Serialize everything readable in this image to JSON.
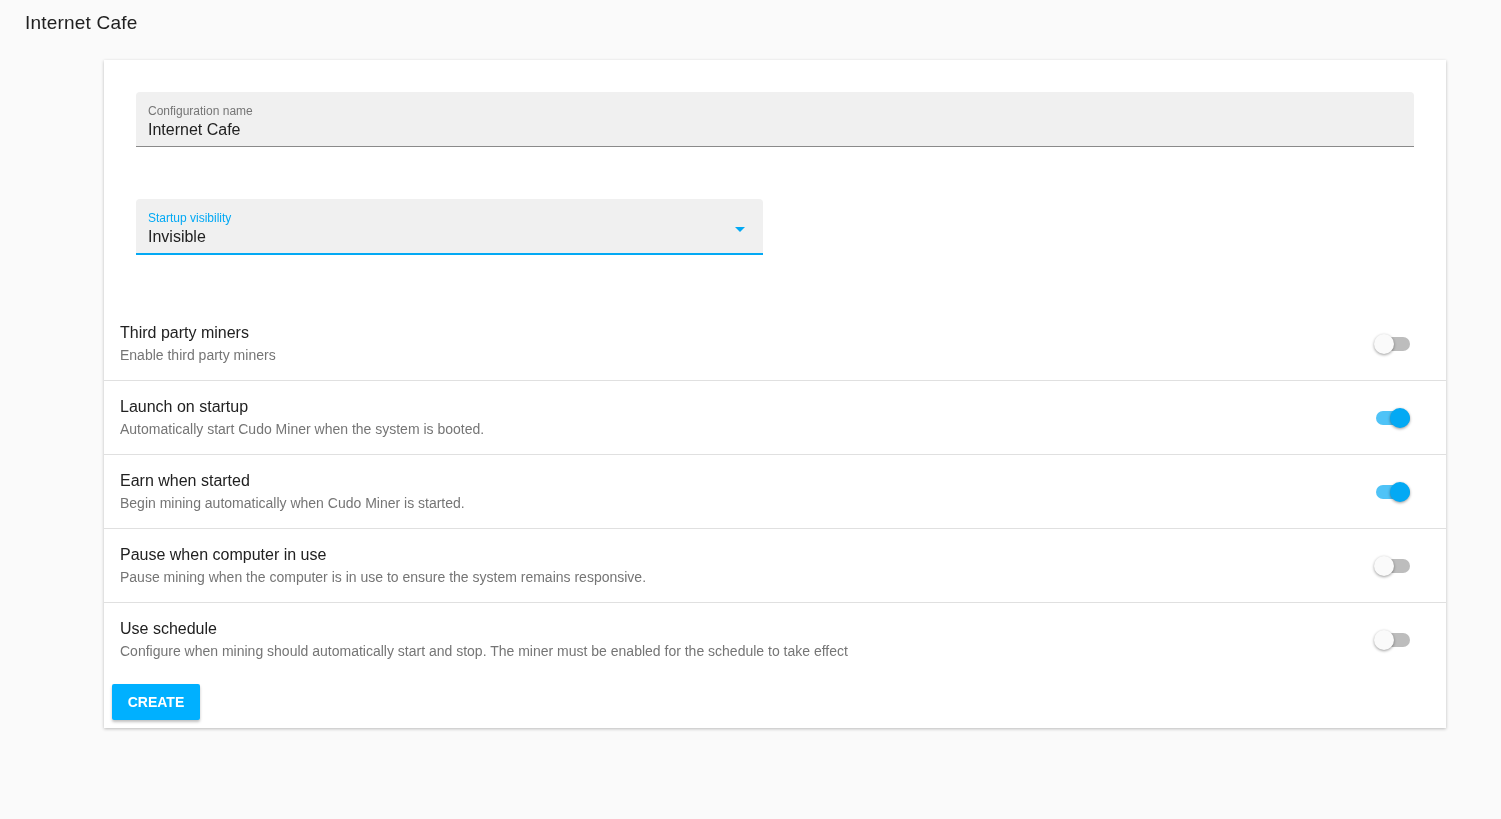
{
  "page_title": "Internet Cafe",
  "name_field": {
    "label": "Configuration name",
    "value": "Internet Cafe"
  },
  "visibility_select": {
    "label": "Startup visibility",
    "value": "Invisible"
  },
  "settings": [
    {
      "title": "Third party miners",
      "description": "Enable third party miners",
      "on": false
    },
    {
      "title": "Launch on startup",
      "description": "Automatically start Cudo Miner when the system is booted.",
      "on": true
    },
    {
      "title": "Earn when started",
      "description": "Begin mining automatically when Cudo Miner is started.",
      "on": true
    },
    {
      "title": "Pause when computer in use",
      "description": "Pause mining when the computer is in use to ensure the system remains responsive.",
      "on": false
    },
    {
      "title": "Use schedule",
      "description": "Configure when mining should automatically start and stop. The miner must be enabled for the schedule to take effect",
      "on": false
    }
  ],
  "create_button": "CREATE"
}
